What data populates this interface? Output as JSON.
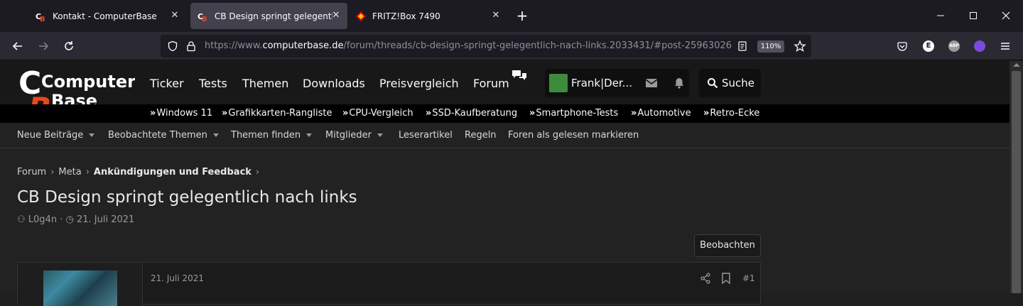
{
  "browser": {
    "tabs": [
      {
        "title": "Kontakt - ComputerBase",
        "icon": "cb-favicon"
      },
      {
        "title": "CB Design springt gelegentlich nach links",
        "icon": "cb-favicon",
        "active": true
      },
      {
        "title": "FRITZ!Box 7490",
        "icon": "fritzbox-favicon"
      }
    ],
    "url_prefix": "https://www.",
    "url_domain": "computerbase.de",
    "url_path": "/forum/threads/cb-design-springt-gelegentlich-nach-links.2033431/#post-25963026",
    "zoom": "110%"
  },
  "site": {
    "logo_line1": "Computer",
    "logo_line2": "Base",
    "nav": [
      "Ticker",
      "Tests",
      "Themen",
      "Downloads",
      "Preisvergleich",
      "Forum"
    ],
    "user_name": "Frank|Der...",
    "search_label": "Suche",
    "subnav": [
      "Windows 11",
      "Grafikkarten-Rangliste",
      "CPU-Vergleich",
      "SSD-Kaufberatung",
      "Smartphone-Tests",
      "Automotive",
      "Retro-Ecke"
    ],
    "secnav": [
      {
        "label": "Neue Beiträge",
        "dropdown": true
      },
      {
        "label": "Beobachtete Themen",
        "dropdown": true
      },
      {
        "label": "Themen finden",
        "dropdown": true
      },
      {
        "label": "Mitglieder",
        "dropdown": true
      },
      {
        "label": "Leserartikel",
        "dropdown": false
      },
      {
        "label": "Regeln",
        "dropdown": false
      },
      {
        "label": "Foren als gelesen markieren",
        "dropdown": false
      }
    ],
    "breadcrumb": [
      "Forum",
      "Meta",
      "Ankündigungen und Feedback"
    ],
    "thread_title": "CB Design springt gelegentlich nach links",
    "author": "L0g4n",
    "date": "21. Juli 2021",
    "watch_label": "Beobachten",
    "post": {
      "date": "21. Juli 2021",
      "number": "#1"
    }
  },
  "colors": {
    "accent": "#e8491d",
    "bg": "#222222",
    "header": "#181818"
  }
}
